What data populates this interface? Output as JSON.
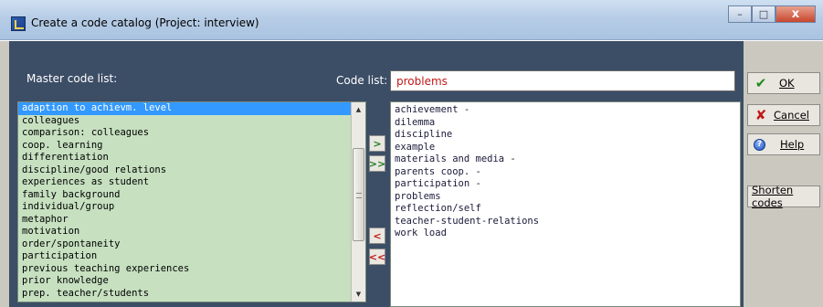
{
  "window": {
    "title": "Create a code catalog (Project: interview)",
    "controls": {
      "minimize": "–",
      "maximize": "□",
      "close": "x"
    }
  },
  "master": {
    "label": "Master code list:",
    "items": [
      "adaption to achievm. level",
      "colleagues",
      "comparison: colleagues",
      "coop. learning",
      "differentiation",
      "discipline/good relations",
      "experiences as student",
      "family background",
      "individual/group",
      "metaphor",
      "motivation",
      "order/spontaneity",
      "participation",
      "previous teaching experiences",
      "prior knowledge",
      "prep. teacher/students"
    ],
    "selected_index": 0
  },
  "codelist": {
    "label": "Code list:",
    "name_value": "problems",
    "items": [
      "achievement -",
      "dilemma",
      "discipline",
      "example",
      "materials and media -",
      "parents coop. -",
      "participation -",
      "problems",
      "reflection/self",
      "teacher-student-relations",
      "work load"
    ]
  },
  "transfer": {
    "add_one": ">",
    "add_all": ">>",
    "remove_one": "<",
    "remove_all": "<<"
  },
  "actions": {
    "ok": "OK",
    "cancel": "Cancel",
    "help": "Help",
    "shorten": "Shorten codes"
  },
  "colors": {
    "main_bg": "#3c4d66",
    "master_list_bg": "#c6e0c0",
    "selection": "#3399ff",
    "input_text": "#c01818"
  }
}
